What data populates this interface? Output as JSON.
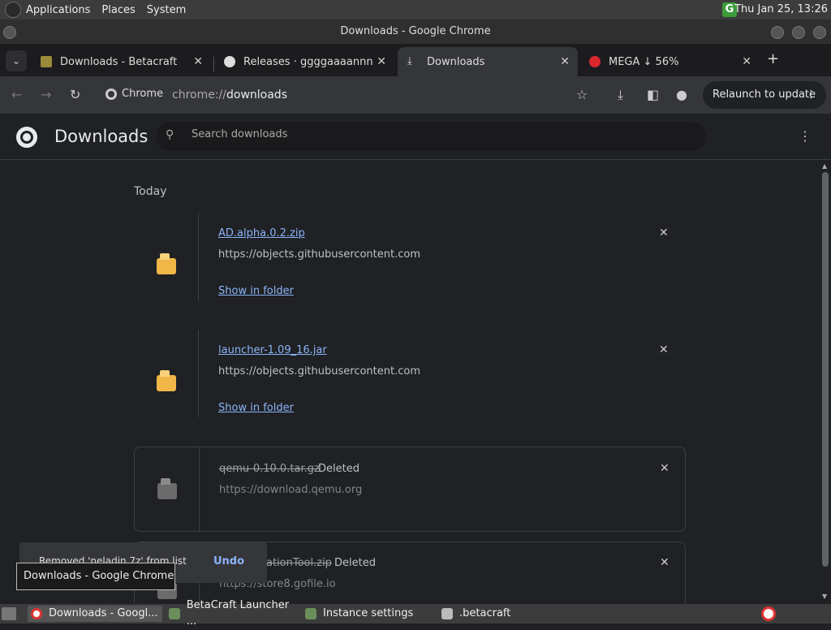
{
  "panel": {
    "menus": [
      "Applications",
      "Places",
      "System"
    ],
    "clock": "Thu Jan 25, 13:26",
    "tray_icon": "G"
  },
  "window": {
    "title": "Downloads - Google Chrome"
  },
  "tabs": [
    {
      "label": "Downloads - Betacraft",
      "icon": "betacraft-icon"
    },
    {
      "label": "Releases · ggggaaaannnng",
      "icon": "github-icon"
    },
    {
      "label": "Downloads",
      "icon": "download-icon",
      "active": true
    },
    {
      "label": "MEGA ↓ 56%",
      "icon": "mega-icon"
    }
  ],
  "toolbar": {
    "chip_label": "Chrome",
    "url_scheme": "chrome://",
    "url_host": "downloads",
    "relaunch_label": "Relaunch to update"
  },
  "page": {
    "title": "Downloads",
    "search_placeholder": "Search downloads",
    "date_header": "Today"
  },
  "downloads": [
    {
      "filename": "AD.alpha.0.2.zip",
      "url": "https://objects.githubusercontent.com",
      "action": "Show in folder",
      "status": ""
    },
    {
      "filename": "launcher-1.09_16.jar",
      "url": "https://objects.githubusercontent.com",
      "action": "Show in folder",
      "status": ""
    },
    {
      "filename": "qemu-0.10.0.tar.gz",
      "url": "https://download.qemu.org",
      "action": "",
      "status": "Deleted"
    },
    {
      "filename": "ationTool.zip",
      "url": "https://store8.gofile.io",
      "action": "",
      "status": "Deleted"
    }
  ],
  "toast": {
    "message": "Removed 'neladin.7z' from list",
    "undo_label": "Undo"
  },
  "tooltip": "Downloads - Google Chrome",
  "taskbar": {
    "items": [
      "Downloads - Googl...",
      "BetaCraft Launcher ...",
      "Instance settings",
      ".betacraft"
    ]
  },
  "colors": {
    "accent": "#8ab4f8",
    "background": "#202124",
    "folder": "#f0b648"
  }
}
